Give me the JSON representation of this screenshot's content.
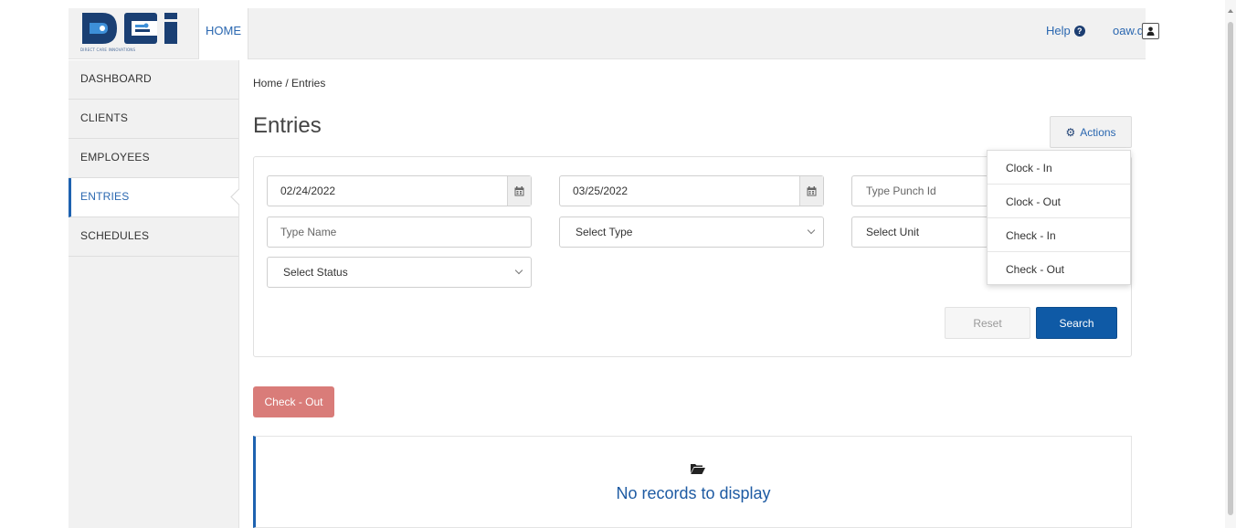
{
  "header": {
    "logo_text": "DCI",
    "logo_subtitle": "DIRECT CARE INNOVATIONS",
    "home_label": "HOME",
    "help_label": "Help",
    "help_icon": "question-circle-icon",
    "username": "oaw.day",
    "user_icon": "user-icon",
    "colors": {
      "brand_blue": "#1e62b0",
      "logo_dark": "#1a3f73",
      "logo_light": "#3d8fd8"
    }
  },
  "sidebar": {
    "items": [
      {
        "label": "DASHBOARD",
        "active": false
      },
      {
        "label": "CLIENTS",
        "active": false
      },
      {
        "label": "EMPLOYEES",
        "active": false
      },
      {
        "label": "ENTRIES",
        "active": true
      },
      {
        "label": "SCHEDULES",
        "active": false
      }
    ]
  },
  "main": {
    "breadcrumb": "Home / Entries",
    "title": "Entries",
    "actions_label": "Actions",
    "actions_icon": "gear-icon",
    "filters": {
      "start_date": "02/24/2022",
      "end_date": "03/25/2022",
      "punch_id_placeholder": "Type Punch Id",
      "name_placeholder": "Type Name",
      "type_select": "Select Type",
      "unit_select": "Select Unit",
      "status_select": "Select Status",
      "calendar_icon": "calendar-icon"
    },
    "reset_label": "Reset",
    "search_label": "Search",
    "checkout_label": "Check - Out",
    "empty_state": {
      "icon": "folder-open-icon",
      "message": "No records to display"
    },
    "colors": {
      "search": "#0f5aa6",
      "checkout": "#d97c79",
      "link": "#2a67b0"
    }
  },
  "actions_menu": {
    "items": [
      {
        "label": "Clock - In"
      },
      {
        "label": "Clock - Out"
      },
      {
        "label": "Check - In"
      },
      {
        "label": "Check - Out"
      }
    ]
  }
}
